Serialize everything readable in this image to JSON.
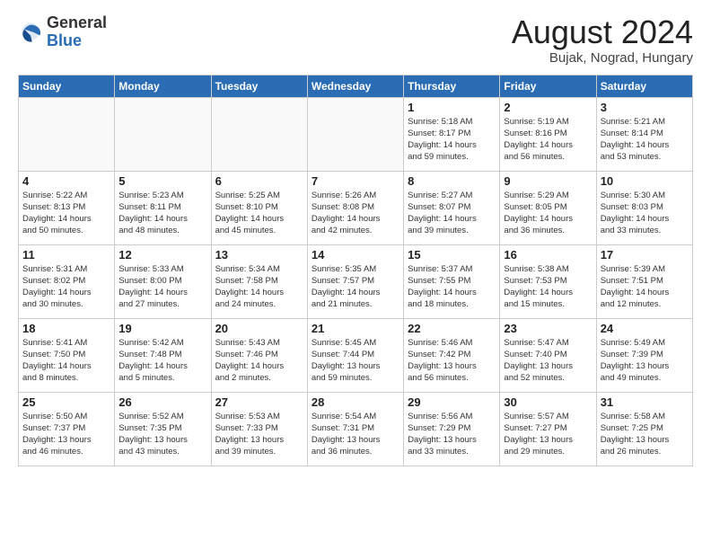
{
  "header": {
    "logo_general": "General",
    "logo_blue": "Blue",
    "month_title": "August 2024",
    "subtitle": "Bujak, Nograd, Hungary"
  },
  "weekdays": [
    "Sunday",
    "Monday",
    "Tuesday",
    "Wednesday",
    "Thursday",
    "Friday",
    "Saturday"
  ],
  "weeks": [
    [
      {
        "day": "",
        "info": ""
      },
      {
        "day": "",
        "info": ""
      },
      {
        "day": "",
        "info": ""
      },
      {
        "day": "",
        "info": ""
      },
      {
        "day": "1",
        "info": "Sunrise: 5:18 AM\nSunset: 8:17 PM\nDaylight: 14 hours\nand 59 minutes."
      },
      {
        "day": "2",
        "info": "Sunrise: 5:19 AM\nSunset: 8:16 PM\nDaylight: 14 hours\nand 56 minutes."
      },
      {
        "day": "3",
        "info": "Sunrise: 5:21 AM\nSunset: 8:14 PM\nDaylight: 14 hours\nand 53 minutes."
      }
    ],
    [
      {
        "day": "4",
        "info": "Sunrise: 5:22 AM\nSunset: 8:13 PM\nDaylight: 14 hours\nand 50 minutes."
      },
      {
        "day": "5",
        "info": "Sunrise: 5:23 AM\nSunset: 8:11 PM\nDaylight: 14 hours\nand 48 minutes."
      },
      {
        "day": "6",
        "info": "Sunrise: 5:25 AM\nSunset: 8:10 PM\nDaylight: 14 hours\nand 45 minutes."
      },
      {
        "day": "7",
        "info": "Sunrise: 5:26 AM\nSunset: 8:08 PM\nDaylight: 14 hours\nand 42 minutes."
      },
      {
        "day": "8",
        "info": "Sunrise: 5:27 AM\nSunset: 8:07 PM\nDaylight: 14 hours\nand 39 minutes."
      },
      {
        "day": "9",
        "info": "Sunrise: 5:29 AM\nSunset: 8:05 PM\nDaylight: 14 hours\nand 36 minutes."
      },
      {
        "day": "10",
        "info": "Sunrise: 5:30 AM\nSunset: 8:03 PM\nDaylight: 14 hours\nand 33 minutes."
      }
    ],
    [
      {
        "day": "11",
        "info": "Sunrise: 5:31 AM\nSunset: 8:02 PM\nDaylight: 14 hours\nand 30 minutes."
      },
      {
        "day": "12",
        "info": "Sunrise: 5:33 AM\nSunset: 8:00 PM\nDaylight: 14 hours\nand 27 minutes."
      },
      {
        "day": "13",
        "info": "Sunrise: 5:34 AM\nSunset: 7:58 PM\nDaylight: 14 hours\nand 24 minutes."
      },
      {
        "day": "14",
        "info": "Sunrise: 5:35 AM\nSunset: 7:57 PM\nDaylight: 14 hours\nand 21 minutes."
      },
      {
        "day": "15",
        "info": "Sunrise: 5:37 AM\nSunset: 7:55 PM\nDaylight: 14 hours\nand 18 minutes."
      },
      {
        "day": "16",
        "info": "Sunrise: 5:38 AM\nSunset: 7:53 PM\nDaylight: 14 hours\nand 15 minutes."
      },
      {
        "day": "17",
        "info": "Sunrise: 5:39 AM\nSunset: 7:51 PM\nDaylight: 14 hours\nand 12 minutes."
      }
    ],
    [
      {
        "day": "18",
        "info": "Sunrise: 5:41 AM\nSunset: 7:50 PM\nDaylight: 14 hours\nand 8 minutes."
      },
      {
        "day": "19",
        "info": "Sunrise: 5:42 AM\nSunset: 7:48 PM\nDaylight: 14 hours\nand 5 minutes."
      },
      {
        "day": "20",
        "info": "Sunrise: 5:43 AM\nSunset: 7:46 PM\nDaylight: 14 hours\nand 2 minutes."
      },
      {
        "day": "21",
        "info": "Sunrise: 5:45 AM\nSunset: 7:44 PM\nDaylight: 13 hours\nand 59 minutes."
      },
      {
        "day": "22",
        "info": "Sunrise: 5:46 AM\nSunset: 7:42 PM\nDaylight: 13 hours\nand 56 minutes."
      },
      {
        "day": "23",
        "info": "Sunrise: 5:47 AM\nSunset: 7:40 PM\nDaylight: 13 hours\nand 52 minutes."
      },
      {
        "day": "24",
        "info": "Sunrise: 5:49 AM\nSunset: 7:39 PM\nDaylight: 13 hours\nand 49 minutes."
      }
    ],
    [
      {
        "day": "25",
        "info": "Sunrise: 5:50 AM\nSunset: 7:37 PM\nDaylight: 13 hours\nand 46 minutes."
      },
      {
        "day": "26",
        "info": "Sunrise: 5:52 AM\nSunset: 7:35 PM\nDaylight: 13 hours\nand 43 minutes."
      },
      {
        "day": "27",
        "info": "Sunrise: 5:53 AM\nSunset: 7:33 PM\nDaylight: 13 hours\nand 39 minutes."
      },
      {
        "day": "28",
        "info": "Sunrise: 5:54 AM\nSunset: 7:31 PM\nDaylight: 13 hours\nand 36 minutes."
      },
      {
        "day": "29",
        "info": "Sunrise: 5:56 AM\nSunset: 7:29 PM\nDaylight: 13 hours\nand 33 minutes."
      },
      {
        "day": "30",
        "info": "Sunrise: 5:57 AM\nSunset: 7:27 PM\nDaylight: 13 hours\nand 29 minutes."
      },
      {
        "day": "31",
        "info": "Sunrise: 5:58 AM\nSunset: 7:25 PM\nDaylight: 13 hours\nand 26 minutes."
      }
    ]
  ]
}
